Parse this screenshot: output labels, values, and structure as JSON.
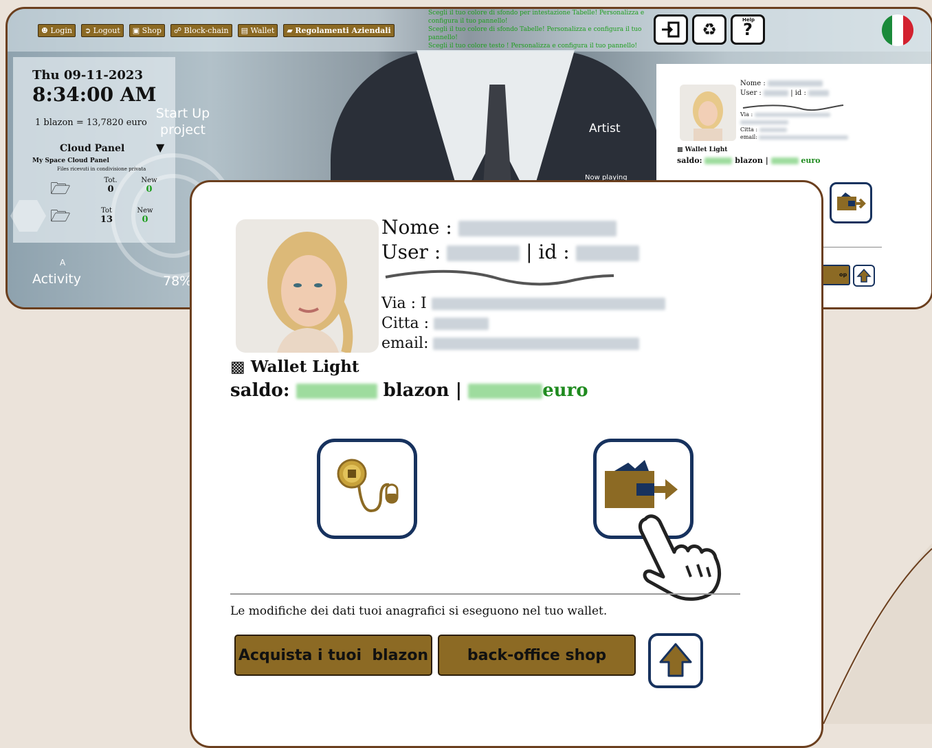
{
  "top_screen": {
    "nav": [
      {
        "icon": "person-icon",
        "label": "Login",
        "bold": false
      },
      {
        "icon": "logout-icon",
        "label": "Logout",
        "bold": false
      },
      {
        "icon": "shop-icon",
        "label": "Shop",
        "bold": false
      },
      {
        "icon": "blockchain-icon",
        "label": "Block-chain",
        "bold": false
      },
      {
        "icon": "wallet-icon",
        "label": "Wallet",
        "bold": false
      },
      {
        "icon": "book-icon",
        "label": "Regolamenti Aziendali",
        "bold": true
      }
    ],
    "color_notes": [
      "Scegli il tuo colore di sfondo per intestazione Tabelle! Personalizza e configura il tuo pannello!",
      "Scegli il tuo colore di sfondo Tabelle! Personalizza e configura il tuo pannello!",
      "Scegli il tuo colore testo ! Personalizza e configura il tuo pannello!"
    ],
    "help_label": "Help",
    "date": "Thu 09-11-2023",
    "time": "8:34:00 AM",
    "rate": "1 blazon = 13,7820 euro",
    "start_up": "Start Up project",
    "cloud_panel": "Cloud Panel",
    "my_space": "My Space Cloud Panel",
    "files_note": "Files ricevuti in condivisione privata",
    "stats": {
      "row1": {
        "tot_label": "Tot.",
        "tot": "0",
        "new_label": "New",
        "new": "0"
      },
      "row2": {
        "tot_label": "Tot",
        "tot": "13",
        "new_label": "New",
        "new": "0"
      }
    },
    "artist": "Artist",
    "now_playing": "Now playing",
    "activity": "Activity",
    "activity_letter": "A",
    "percent": "78%",
    "mini_card": {
      "nome_label": "Nome :",
      "user_label": "User :",
      "id_label": "| id :",
      "via_label": "Via :",
      "citta_label": "Citta :",
      "email_label": "email:",
      "wallet_label": "Wallet Light",
      "saldo_label": "saldo:",
      "blazon_label": "blazon |",
      "euro_label": "euro",
      "shop_fragment": "op"
    }
  },
  "card": {
    "nome_label": "Nome :",
    "user_label": "User :",
    "id_label": "| id :",
    "via_label": "Via : I",
    "citta_label": "Citta :",
    "email_label": "email:",
    "wallet_label": "Wallet Light",
    "saldo_label": "saldo:",
    "blazon_label": "blazon |",
    "euro_label": "euro",
    "note": "Le modifiche dei dati tuoi anagrafici si eseguono nel tuo wallet.",
    "buy_button": "Acquista i tuoi  blazon",
    "backoffice_button": "back-office shop"
  },
  "colors": {
    "gold": "#8c6a24",
    "navy": "#17325e",
    "frame": "#6b3f1e",
    "green": "#1e8a1e"
  }
}
